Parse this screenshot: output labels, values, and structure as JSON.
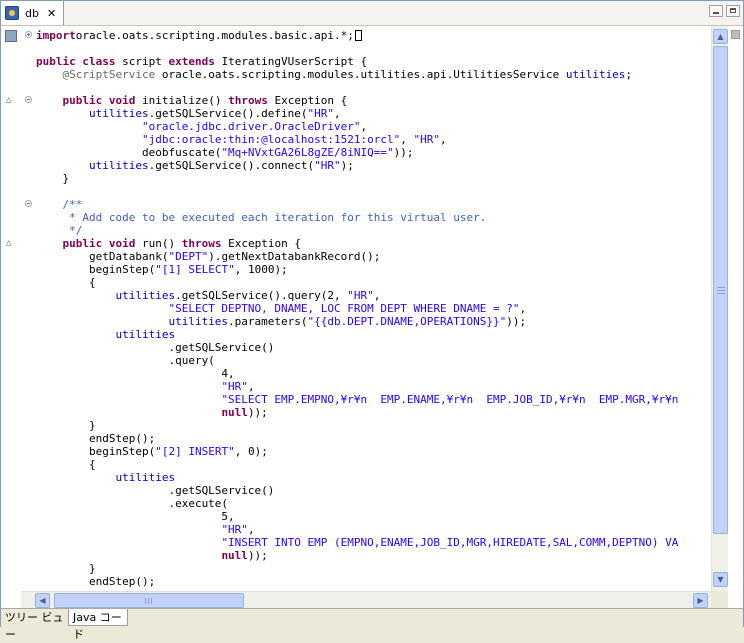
{
  "tab": {
    "title": "db",
    "close": "✕"
  },
  "icons": {
    "tab": "java-file-icon",
    "close": "close-icon",
    "up": "triangle-up-icon",
    "down": "triangle-down-icon",
    "left": "triangle-left-icon",
    "right": "triangle-right-icon"
  },
  "bottom_tabs": [
    "ツリー ビュー",
    "Java コード"
  ],
  "code_lines": [
    {
      "fold": "plus",
      "tokens": [
        [
          "kw",
          "import"
        ],
        [
          "",
          "oracle.oats.scripting.modules.basic.api.*;"
        ]
      ],
      "cursor": true
    },
    {
      "tokens": []
    },
    {
      "tokens": [
        [
          "kw",
          "public class"
        ],
        [
          "",
          " script "
        ],
        [
          "kw",
          "extends"
        ],
        [
          "",
          " IteratingVUserScript {"
        ]
      ]
    },
    {
      "tokens": [
        [
          "ann",
          "    @ScriptService"
        ],
        [
          "",
          " oracle.oats.scripting.modules.utilities.api.UtilitiesService "
        ],
        [
          "fld",
          "utilities"
        ],
        [
          "",
          ";"
        ]
      ]
    },
    {
      "tokens": []
    },
    {
      "override": true,
      "fold": "minus",
      "tokens": [
        [
          "",
          "    "
        ],
        [
          "kw",
          "public void"
        ],
        [
          "",
          " initialize() "
        ],
        [
          "kw",
          "throws"
        ],
        [
          "",
          " Exception {"
        ]
      ]
    },
    {
      "tokens": [
        [
          "",
          "        "
        ],
        [
          "fld",
          "utilities"
        ],
        [
          "",
          ".getSQLService().define("
        ],
        [
          "str",
          "\"HR\""
        ],
        [
          "",
          ","
        ]
      ]
    },
    {
      "tokens": [
        [
          "",
          "                "
        ],
        [
          "str",
          "\"oracle.jdbc.driver.OracleDriver\""
        ],
        [
          "",
          ","
        ]
      ]
    },
    {
      "tokens": [
        [
          "",
          "                "
        ],
        [
          "str",
          "\"jdbc:oracle:thin:@localhost:1521:orcl\""
        ],
        [
          "",
          ", "
        ],
        [
          "str",
          "\"HR\""
        ],
        [
          "",
          ","
        ]
      ]
    },
    {
      "tokens": [
        [
          "",
          "                deobfuscate("
        ],
        [
          "str",
          "\"Mq+NVxtGA26L8gZE/8iNIQ==\""
        ],
        [
          "",
          "));"
        ]
      ]
    },
    {
      "tokens": [
        [
          "",
          "        "
        ],
        [
          "fld",
          "utilities"
        ],
        [
          "",
          ".getSQLService().connect("
        ],
        [
          "str",
          "\"HR\""
        ],
        [
          "",
          ");"
        ]
      ]
    },
    {
      "tokens": [
        [
          "",
          "    }"
        ]
      ]
    },
    {
      "tokens": []
    },
    {
      "fold": "minus",
      "tokens": [
        [
          "cmt",
          "    /**"
        ]
      ]
    },
    {
      "tokens": [
        [
          "cmt",
          "     * Add code to be executed each iteration for this virtual user."
        ]
      ]
    },
    {
      "tokens": [
        [
          "cmt",
          "     */"
        ]
      ]
    },
    {
      "override": true,
      "tokens": [
        [
          "",
          "    "
        ],
        [
          "kw",
          "public void"
        ],
        [
          "",
          " run() "
        ],
        [
          "kw",
          "throws"
        ],
        [
          "",
          " Exception {"
        ]
      ]
    },
    {
      "tokens": [
        [
          "",
          "        getDatabank("
        ],
        [
          "str",
          "\"DEPT\""
        ],
        [
          "",
          ").getNextDatabankRecord();"
        ]
      ]
    },
    {
      "tokens": [
        [
          "",
          "        beginStep("
        ],
        [
          "str",
          "\"[1] SELECT\""
        ],
        [
          "",
          ", 1000);"
        ]
      ]
    },
    {
      "tokens": [
        [
          "",
          "        {"
        ]
      ]
    },
    {
      "tokens": [
        [
          "",
          "            "
        ],
        [
          "fld",
          "utilities"
        ],
        [
          "",
          ".getSQLService().query(2, "
        ],
        [
          "str",
          "\"HR\""
        ],
        [
          "",
          ","
        ]
      ]
    },
    {
      "tokens": [
        [
          "",
          "                    "
        ],
        [
          "str",
          "\"SELECT DEPTNO, DNAME, LOC FROM DEPT WHERE DNAME = ?\""
        ],
        [
          "",
          ","
        ]
      ]
    },
    {
      "tokens": [
        [
          "",
          "                    "
        ],
        [
          "fld",
          "utilities"
        ],
        [
          "",
          ".parameters("
        ],
        [
          "str",
          "\"{{db.DEPT.DNAME,OPERATIONS}}\""
        ],
        [
          "",
          "));"
        ]
      ]
    },
    {
      "tokens": [
        [
          "",
          "            "
        ],
        [
          "fld",
          "utilities"
        ]
      ]
    },
    {
      "tokens": [
        [
          "",
          "                    .getSQLService()"
        ]
      ]
    },
    {
      "tokens": [
        [
          "",
          "                    .query("
        ]
      ]
    },
    {
      "tokens": [
        [
          "",
          "                            4,"
        ]
      ]
    },
    {
      "tokens": [
        [
          "",
          "                            "
        ],
        [
          "str",
          "\"HR\""
        ],
        [
          "",
          ","
        ]
      ]
    },
    {
      "tokens": [
        [
          "",
          "                            "
        ],
        [
          "str",
          "\"SELECT EMP.EMPNO,¥r¥n  EMP.ENAME,¥r¥n  EMP.JOB_ID,¥r¥n  EMP.MGR,¥r¥n"
        ]
      ]
    },
    {
      "tokens": [
        [
          "",
          "                            "
        ],
        [
          "kw",
          "null"
        ],
        [
          "",
          "));"
        ]
      ]
    },
    {
      "tokens": [
        [
          "",
          "        }"
        ]
      ]
    },
    {
      "tokens": [
        [
          "",
          "        endStep();"
        ]
      ]
    },
    {
      "tokens": [
        [
          "",
          "        beginStep("
        ],
        [
          "str",
          "\"[2] INSERT\""
        ],
        [
          "",
          ", 0);"
        ]
      ]
    },
    {
      "tokens": [
        [
          "",
          "        {"
        ]
      ]
    },
    {
      "tokens": [
        [
          "",
          "            "
        ],
        [
          "fld",
          "utilities"
        ]
      ]
    },
    {
      "tokens": [
        [
          "",
          "                    .getSQLService()"
        ]
      ]
    },
    {
      "tokens": [
        [
          "",
          "                    .execute("
        ]
      ]
    },
    {
      "tokens": [
        [
          "",
          "                            5,"
        ]
      ]
    },
    {
      "tokens": [
        [
          "",
          "                            "
        ],
        [
          "str",
          "\"HR\""
        ],
        [
          "",
          ","
        ]
      ]
    },
    {
      "tokens": [
        [
          "",
          "                            "
        ],
        [
          "str",
          "\"INSERT INTO EMP (EMPNO,ENAME,JOB_ID,MGR,HIREDATE,SAL,COMM,DEPTNO) VA"
        ]
      ]
    },
    {
      "tokens": [
        [
          "",
          "                            "
        ],
        [
          "kw",
          "null"
        ],
        [
          "",
          "));"
        ]
      ]
    },
    {
      "tokens": [
        [
          "",
          "        }"
        ]
      ]
    },
    {
      "tokens": [
        [
          "",
          "        endStep();"
        ]
      ]
    }
  ]
}
